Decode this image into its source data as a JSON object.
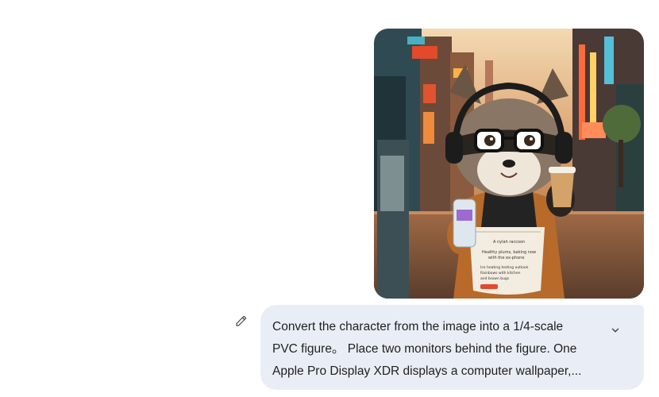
{
  "image": {
    "icon": "raccoon-barista-illustration",
    "apron_text": [
      "A nylah raccoon",
      "Healthy plums, baking now",
      "with the ex-phone",
      "Ice heating testing outlook",
      "Rainbows with kitchen",
      "and brown bugs"
    ]
  },
  "message": {
    "lines": [
      "Convert the character from the image into a 1/4-scale",
      "PVC figure。 Place two monitors behind the figure. One",
      "Apple Pro Display XDR displays a computer wallpaper,..."
    ],
    "edit_icon": "pencil-icon",
    "expand_icon": "chevron-down-icon"
  },
  "colors": {
    "bubble_bg": "#e9eef6",
    "text": "#1f1f1f",
    "icon": "#444746"
  }
}
